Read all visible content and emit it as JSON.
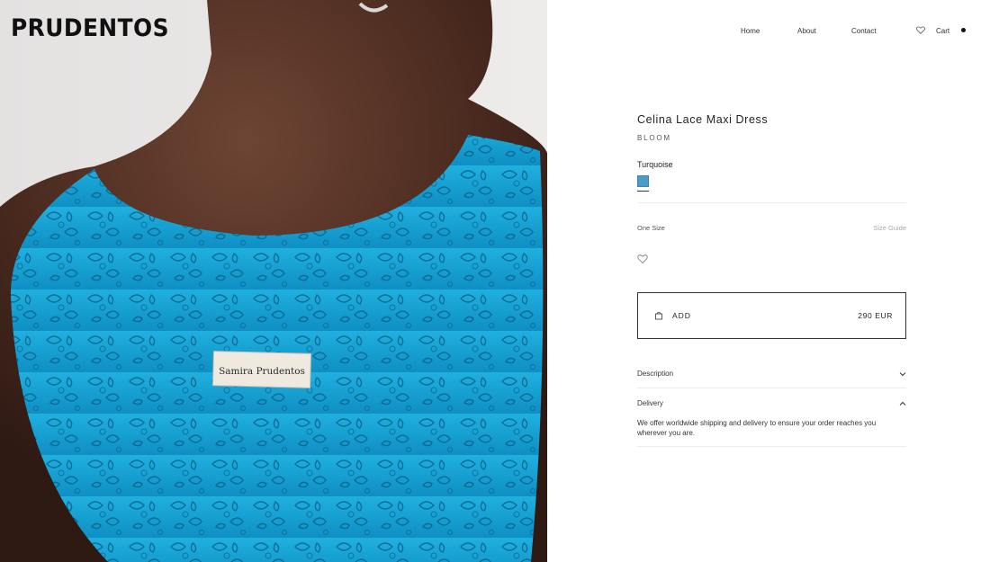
{
  "brand": {
    "logo_text": "PRUDENTOS"
  },
  "nav": {
    "items": [
      "Home",
      "About",
      "Contact"
    ],
    "cart_label": "Cart",
    "wishlist_icon": "heart-icon"
  },
  "image": {
    "label_text": "Samira Prudentos",
    "dress_color": "#1aa3d6"
  },
  "product": {
    "name": "Celina Lace Maxi Dress",
    "collection": "BLOOM",
    "color_name": "Turquoise",
    "swatch_color": "#4b9bc9",
    "size": "One Size",
    "size_guide": "Size Guide",
    "add_label": "ADD",
    "price": "290 EUR"
  },
  "accordion": {
    "description_label": "Description",
    "delivery_label": "Delivery",
    "delivery_text": "We offer worldwide shipping and delivery to ensure your order reaches you wherever you are."
  }
}
